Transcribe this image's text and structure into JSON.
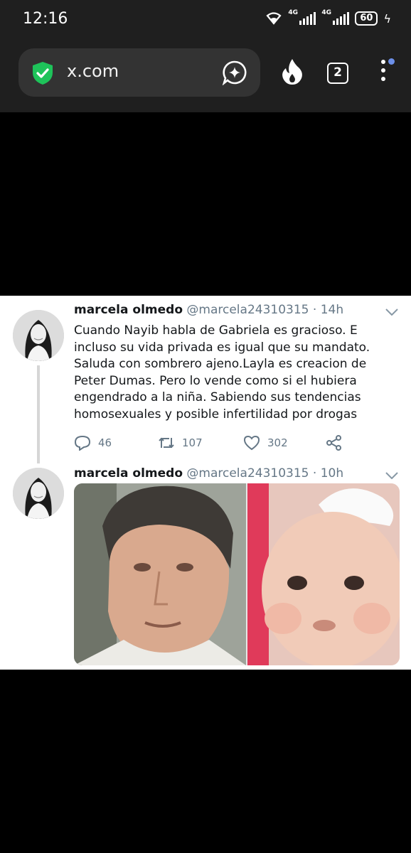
{
  "status_bar": {
    "time": "12:16",
    "network_1": "4G",
    "network_2": "4G",
    "battery": "60"
  },
  "browser": {
    "url": "x.com",
    "tab_count": "2",
    "icons": [
      "shield-check-icon",
      "ai-assistant-icon",
      "fire-icon",
      "tabs-icon",
      "more-menu-icon"
    ]
  },
  "tweets": [
    {
      "name": "marcela olmedo",
      "handle": "@marcela24310315",
      "time": "· 14h",
      "text": "Cuando Nayib habla de Gabriela es gracioso. E incluso su vida privada es igual que su mandato. Saluda con sombrero ajeno.Layla es creacion de Peter Dumas. Pero lo vende como si el hubiera engendrado a la niña. Sabiendo sus tendencias homosexuales y posible infertilidad por drogas",
      "replies": "46",
      "retweets": "107",
      "likes": "302"
    },
    {
      "name": "marcela olmedo",
      "handle": "@marcela24310315",
      "time": "· 10h"
    }
  ],
  "colors": {
    "browser_bg": "#1f1f1f",
    "urlbar_bg": "#333333",
    "shield_green": "#1ec35a",
    "tweet_text": "#14171a",
    "tweet_secondary": "#657786"
  }
}
